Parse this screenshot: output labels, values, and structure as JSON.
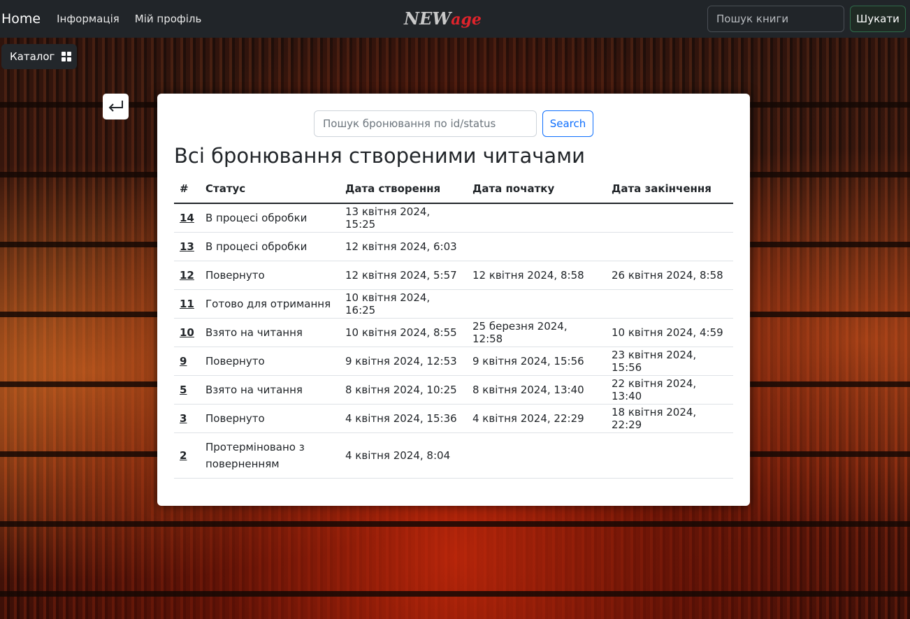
{
  "navbar": {
    "home": "Home",
    "links": [
      "Інформація",
      "Мій профіль"
    ],
    "logo_part1": "NEW",
    "logo_part2": "age",
    "search_placeholder": "Пошук книги",
    "search_button": "Шукати"
  },
  "catalog": {
    "label": "Каталог",
    "icon": "grid-icon"
  },
  "back": {
    "icon": "return-arrow-icon"
  },
  "card": {
    "search_placeholder": "Пошук бронювання по id/status",
    "search_button": "Search",
    "title": "Всі бронювання створеними читачами"
  },
  "table": {
    "headers": [
      "#",
      "Статус",
      "Дата створення",
      "Дата початку",
      "Дата закінчення"
    ],
    "rows": [
      {
        "id": "14",
        "status": "В процесі обробки",
        "created": "13 квітня 2024, 15:25",
        "start": "",
        "end": ""
      },
      {
        "id": "13",
        "status": "В процесі обробки",
        "created": "12 квітня 2024, 6:03",
        "start": "",
        "end": ""
      },
      {
        "id": "12",
        "status": "Повернуто",
        "created": "12 квітня 2024, 5:57",
        "start": "12 квітня 2024, 8:58",
        "end": "26 квітня 2024, 8:58"
      },
      {
        "id": "11",
        "status": "Готово для отримання",
        "created": "10 квітня 2024, 16:25",
        "start": "",
        "end": ""
      },
      {
        "id": "10",
        "status": "Взято на читання",
        "created": "10 квітня 2024, 8:55",
        "start": "25 березня 2024, 12:58",
        "end": "10 квітня 2024, 4:59"
      },
      {
        "id": "9",
        "status": "Повернуто",
        "created": "9 квітня 2024, 12:53",
        "start": "9 квітня 2024, 15:56",
        "end": "23 квітня 2024, 15:56"
      },
      {
        "id": "5",
        "status": "Взято на читання",
        "created": "8 квітня 2024, 10:25",
        "start": "8 квітня 2024, 13:40",
        "end": "22 квітня 2024, 13:40"
      },
      {
        "id": "3",
        "status": "Повернуто",
        "created": "4 квітня 2024, 15:36",
        "start": "4 квітня 2024, 22:29",
        "end": "18 квітня 2024, 22:29"
      },
      {
        "id": "2",
        "status": "Протерміновано з поверненням",
        "created": "4 квітня 2024, 8:04",
        "start": "",
        "end": ""
      }
    ]
  }
}
